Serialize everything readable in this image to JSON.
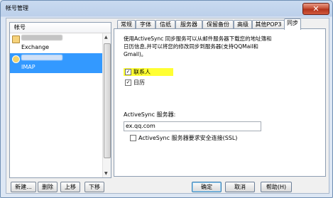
{
  "window": {
    "title": "帐号管理",
    "close_symbol": "✕"
  },
  "accounts": {
    "header": "帐号",
    "items": [
      {
        "name": "",
        "type": "Exchange",
        "selected": false
      },
      {
        "name": "",
        "type": "IMAP",
        "selected": true
      }
    ],
    "buttons": {
      "new": "新建...",
      "delete": "删除",
      "up": "上移",
      "down": "下移"
    }
  },
  "tabs": [
    "常规",
    "字体",
    "信纸",
    "服务器",
    "保留备份",
    "高级",
    "其他POP3",
    "同步"
  ],
  "active_tab": "同步",
  "sync": {
    "description": "使用ActiveSync 同步服务可以从邮件服务器下载您的地址簿和日历信息,并可以将您的修改同步到服务器(支持QQMail和Gmail)。",
    "contacts_label": "联系人",
    "contacts_checked": true,
    "calendar_label": "日历",
    "calendar_checked": true,
    "server_label": "ActiveSync 服务器:",
    "server_value": "ex.qq.com",
    "ssl_label": "ActiveSync 服务器要求安全连接(SSL)",
    "ssl_checked": false,
    "check_mark": "✓"
  },
  "buttons": {
    "ok": "确定",
    "cancel": "取消",
    "help": "帮助(H)"
  },
  "colors": {
    "selection": "#3399ff",
    "highlight": "#ffff33",
    "close": "#c24a2f"
  }
}
